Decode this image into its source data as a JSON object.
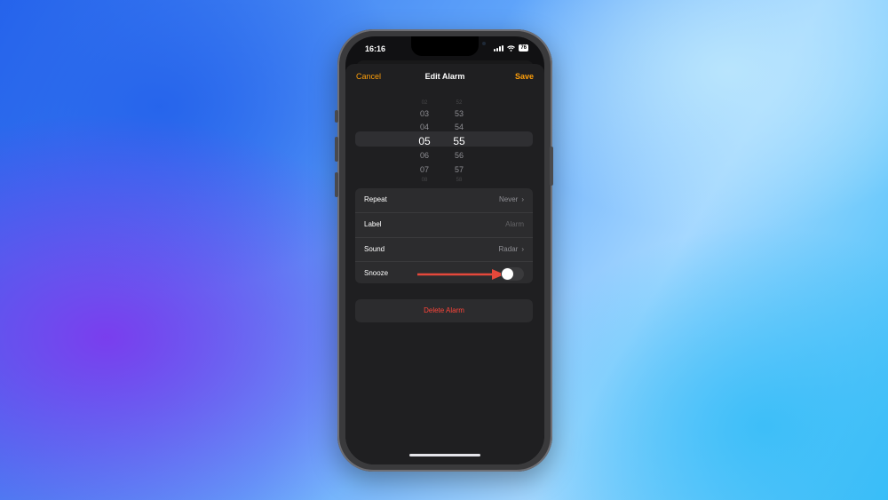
{
  "status_bar": {
    "time": "16:16",
    "battery": "76",
    "icons": [
      "signal-icon",
      "wifi-icon",
      "battery-icon"
    ]
  },
  "nav": {
    "cancel_label": "Cancel",
    "title": "Edit Alarm",
    "save_label": "Save"
  },
  "time_picker": {
    "hours": [
      "02",
      "03",
      "04",
      "05",
      "06",
      "07",
      "08"
    ],
    "minutes": [
      "52",
      "53",
      "54",
      "55",
      "56",
      "57",
      "58"
    ],
    "selected_hour": "05",
    "selected_minute": "55"
  },
  "settings": {
    "repeat": {
      "label": "Repeat",
      "value": "Never"
    },
    "label": {
      "label": "Label",
      "placeholder": "Alarm"
    },
    "sound": {
      "label": "Sound",
      "value": "Radar"
    },
    "snooze": {
      "label": "Snooze",
      "enabled": false
    }
  },
  "delete_button": {
    "label": "Delete Alarm"
  },
  "colors": {
    "accent": "#ff9f0a",
    "destructive": "#ff453a",
    "annotation_arrow": "#e5483b"
  }
}
